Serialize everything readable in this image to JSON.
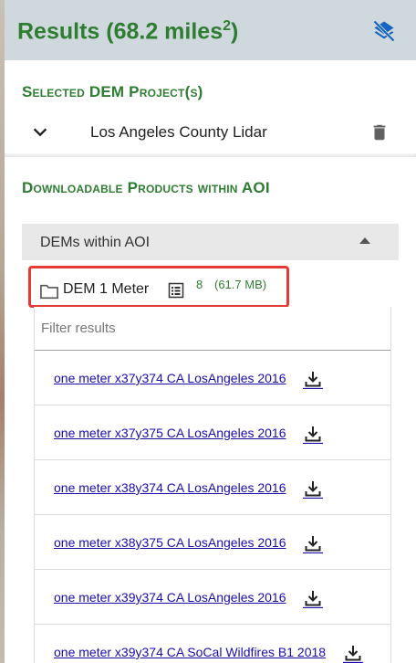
{
  "header": {
    "title": "Results (68.2 miles",
    "title_sup": "2",
    "title_close": ")",
    "layers_icon": "layers-clear-icon"
  },
  "selected_projects": {
    "heading": "Selected DEM Project(s)",
    "items": [
      {
        "name": "Los Angeles County Lidar"
      }
    ]
  },
  "products": {
    "heading": "Downloadable Products within AOI",
    "accordion_label": "DEMs within AOI",
    "folder": {
      "name": "DEM 1 Meter",
      "count": "8",
      "size": "(61.7 MB)"
    },
    "filter_placeholder": "Filter results",
    "files": [
      "one meter x37y374 CA LosAngeles 2016",
      "one meter x37y375 CA LosAngeles 2016",
      "one meter x38y374 CA LosAngeles 2016",
      "one meter x38y375 CA LosAngeles 2016",
      "one meter x39y374 CA LosAngeles 2016",
      "one meter x39y374 CA SoCal Wildfires B1 2018"
    ]
  },
  "colors": {
    "accent_green": "#2e7d32",
    "header_bg": "#cfd8dc",
    "link_blue": "#1a0dab",
    "highlight_red": "#e53935",
    "icon_blue": "#1565c0"
  }
}
